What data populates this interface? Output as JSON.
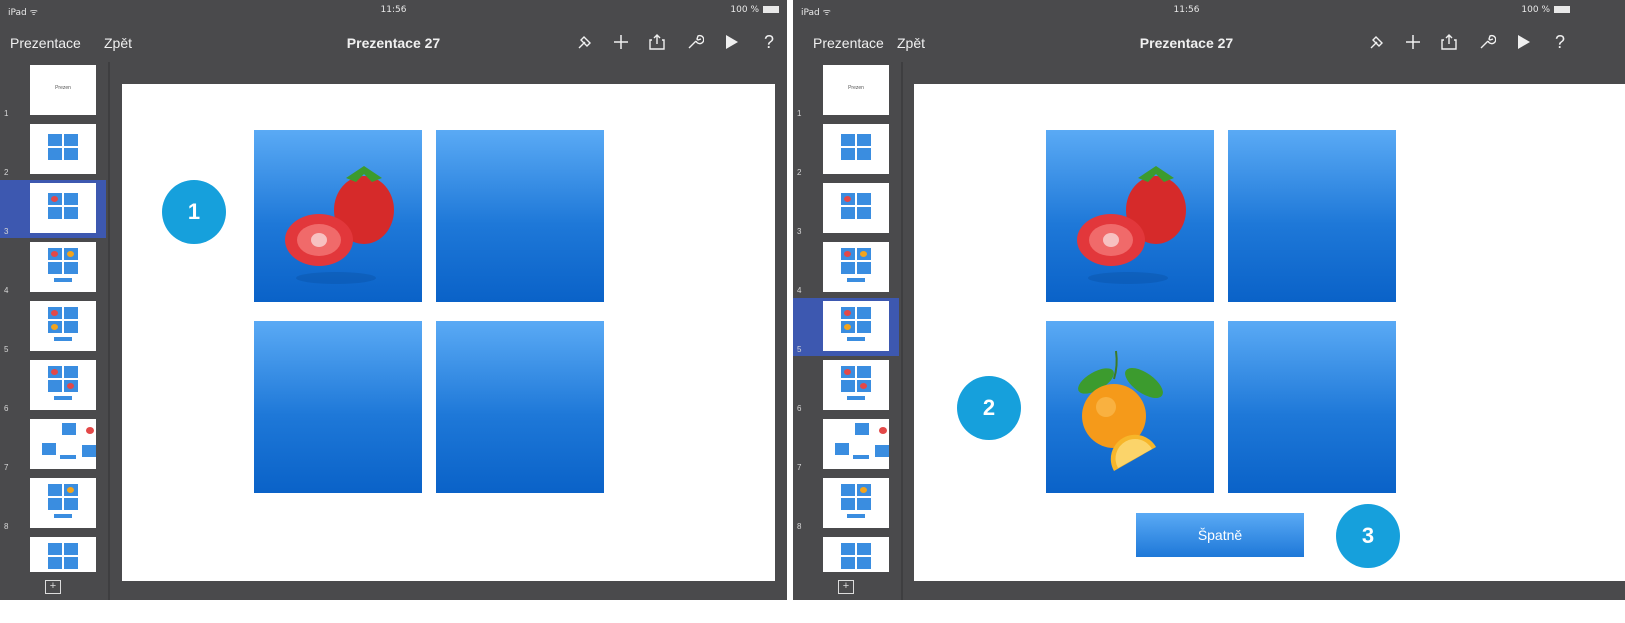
{
  "screens": [
    {
      "status": {
        "device": "iPad ᯤ",
        "time": "11:56",
        "battery": "100 %"
      },
      "toolbar": {
        "presentations": "Prezentace",
        "back": "Zpět",
        "title": "Prezentace 27",
        "help": "?"
      },
      "selected_slide": 3,
      "step_badge": "1"
    },
    {
      "status": {
        "device": "iPad ᯤ",
        "time": "11:56",
        "battery": "100 %"
      },
      "toolbar": {
        "presentations": "Prezentace",
        "back": "Zpět",
        "title": "Prezentace 27",
        "help": "?"
      },
      "selected_slide": 5,
      "step_badge": "2",
      "step_badge_2": "3",
      "answer_button": "Špatně"
    }
  ],
  "slides": [
    {
      "number": "1",
      "label": "Prezen"
    },
    {
      "number": "2"
    },
    {
      "number": "3"
    },
    {
      "number": "4"
    },
    {
      "number": "5"
    },
    {
      "number": "6"
    },
    {
      "number": "7"
    },
    {
      "number": "8"
    },
    {
      "number": ""
    }
  ],
  "icons": [
    "brush-icon",
    "plus-icon",
    "share-icon",
    "wrench-icon",
    "play-icon",
    "help-icon",
    "add-slide-icon"
  ],
  "colors": {
    "toolbar": "#4a4a4c",
    "card": "#1e78d8",
    "badge": "#16a0dc",
    "selection": "#3d58b0"
  }
}
